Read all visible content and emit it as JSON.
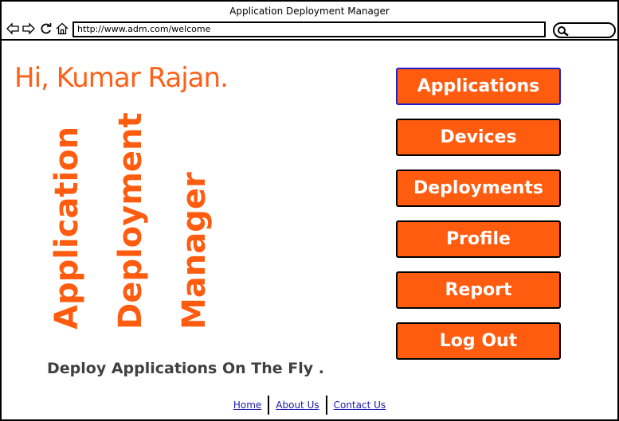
{
  "window": {
    "title": "Application Deployment Manager"
  },
  "browser": {
    "url": "http://www.adm.com/welcome",
    "icons": [
      "back-icon",
      "forward-icon",
      "reload-icon",
      "home-icon",
      "search-icon"
    ]
  },
  "main": {
    "greeting": "Hi, Kumar Rajan.",
    "vertical_title": [
      "Application",
      "Deployment",
      "Manager"
    ],
    "tagline": "Deploy Applications On The Fly ."
  },
  "menu": {
    "items": [
      {
        "label": "Applications",
        "active": true
      },
      {
        "label": "Devices",
        "active": false
      },
      {
        "label": "Deployments",
        "active": false
      },
      {
        "label": "Profile",
        "active": false
      },
      {
        "label": "Report",
        "active": false
      },
      {
        "label": "Log Out",
        "active": false
      }
    ]
  },
  "footer": {
    "links": [
      "Home",
      "About Us",
      "Contact Us"
    ]
  },
  "colors": {
    "accent": "#ff5c10",
    "active_border": "#2020c8",
    "tagline": "#404040",
    "link": "#1a1ab0"
  }
}
